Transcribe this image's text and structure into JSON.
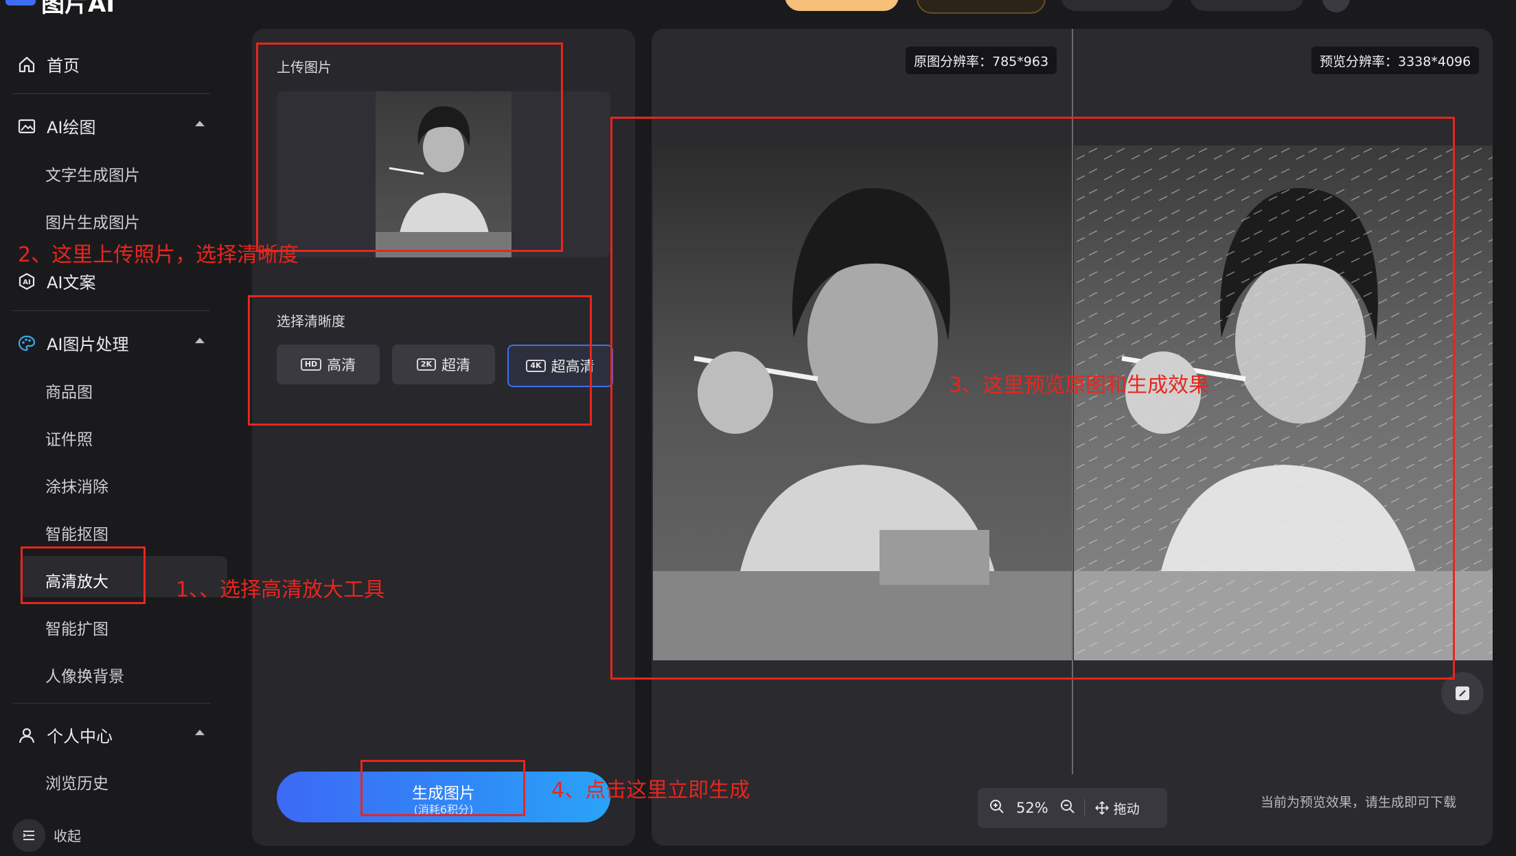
{
  "app": {
    "title": "图片AI"
  },
  "sidebar": {
    "home": "首页",
    "ai_draw": {
      "label": "AI绘图",
      "items": [
        "文字生成图片",
        "图片生成图片"
      ]
    },
    "ai_copy": "AI文案",
    "ai_image": {
      "label": "AI图片处理",
      "items": [
        "商品图",
        "证件照",
        "涂抹消除",
        "智能抠图",
        "高清放大",
        "智能扩图",
        "人像换背景"
      ]
    },
    "personal": {
      "label": "个人中心",
      "items": [
        "浏览历史"
      ]
    },
    "collapse": "收起",
    "active_item": "高清放大"
  },
  "panel": {
    "upload_title": "上传图片",
    "quality_title": "选择清晰度",
    "options": [
      {
        "badge": "HD",
        "label": "高清"
      },
      {
        "badge": "2K",
        "label": "超清"
      },
      {
        "badge": "4K",
        "label": "超高清"
      }
    ],
    "selected_option": "超高清",
    "generate": {
      "label": "生成图片",
      "sub": "(消耗6积分)"
    }
  },
  "preview": {
    "original_res": "原图分辨率：785*963",
    "preview_res": "预览分辨率：3338*4096",
    "zoom": "52%",
    "drag": "拖动",
    "hint": "当前为预览效果，请生成即可下载"
  },
  "annotations": {
    "step1": "1、、选择高清放大工具",
    "step2": "2、这里上传照片，选择清晰度",
    "step3": "3、这里预览原图和生成效果",
    "step4": "4、点击这里立即生成"
  },
  "colors": {
    "accent": "#3f6ff0",
    "annotation": "#e8261d",
    "background": "#1a1a1d"
  }
}
